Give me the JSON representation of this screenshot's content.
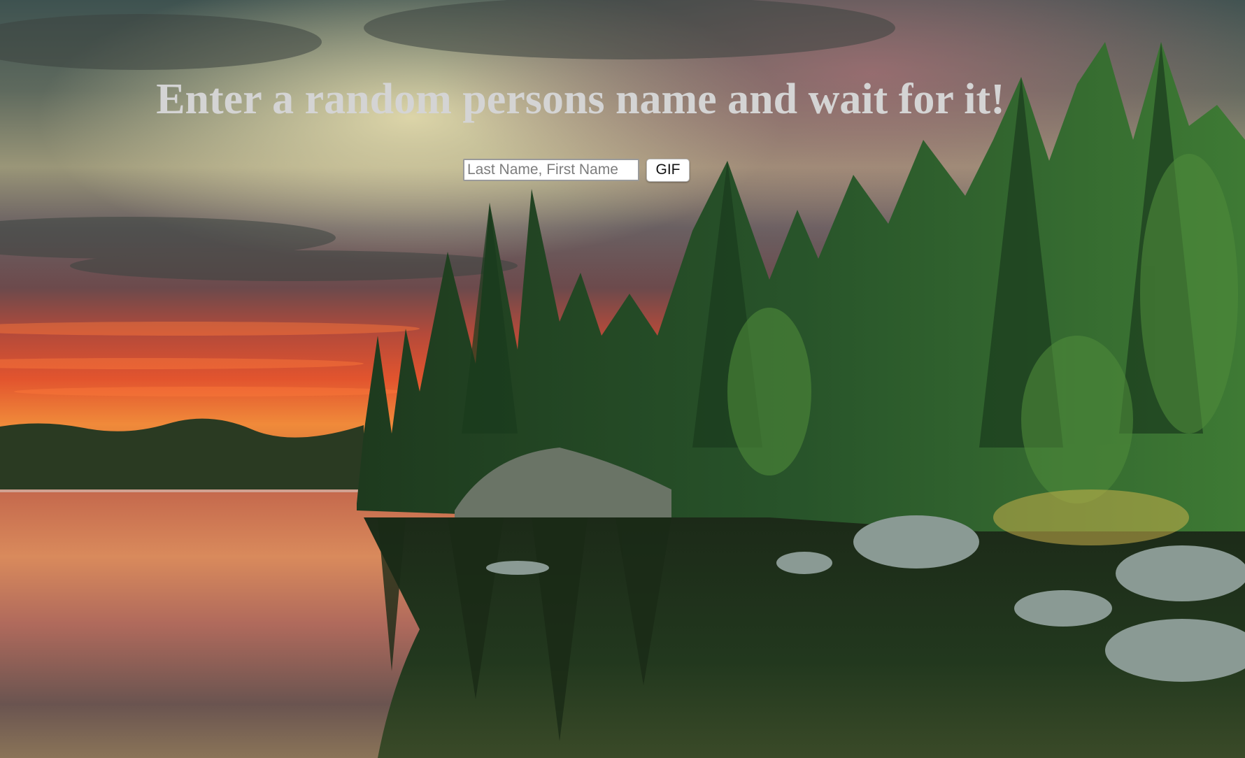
{
  "page": {
    "headline": "Enter a random persons name and wait for it!"
  },
  "form": {
    "input_value": "",
    "input_placeholder": "Last Name, First Name",
    "button_label": "GIF"
  },
  "background": {
    "description_icon": "landscape-background"
  },
  "colors": {
    "headline": "#d4d4d4",
    "button_bg": "#ffffff",
    "input_border": "#9a9a9a"
  }
}
